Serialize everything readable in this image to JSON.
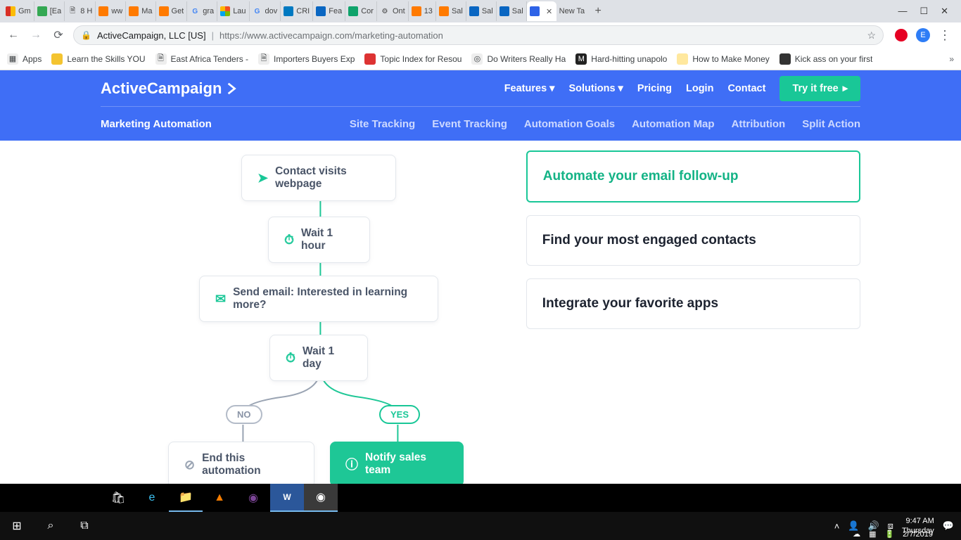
{
  "browser": {
    "tabs": [
      {
        "title": "Gm",
        "color": "#d93025"
      },
      {
        "title": "[Ea",
        "color": "#34a853"
      },
      {
        "title": "8 H",
        "color": "#ffffff"
      },
      {
        "title": "ww",
        "color": "#ff7a00"
      },
      {
        "title": "Ma",
        "color": "#ff7a00"
      },
      {
        "title": "Get",
        "color": "#ff7a00"
      },
      {
        "title": "gra",
        "color": "#4285f4"
      },
      {
        "title": "Lau",
        "color": "#00a4ef"
      },
      {
        "title": "dov",
        "color": "#4285f4"
      },
      {
        "title": "CRI",
        "color": "#0079c1"
      },
      {
        "title": "Fea",
        "color": "#0a66c2"
      },
      {
        "title": "Cor",
        "color": "#0fa36b"
      },
      {
        "title": "Ont",
        "color": "#555"
      },
      {
        "title": "13",
        "color": "#ff7a00"
      },
      {
        "title": "Sal",
        "color": "#ff7a00"
      },
      {
        "title": "Sal",
        "color": "#0a66c2"
      },
      {
        "title": "Sal",
        "color": "#0a66c2"
      }
    ],
    "active_tab_title": "",
    "new_tab_title": "New Ta",
    "origin": "ActiveCampaign, LLC [US]",
    "url_path": "https://www.activecampaign.com/marketing-automation",
    "avatar_letter": "E",
    "bookmarks": [
      {
        "label": "Apps"
      },
      {
        "label": "Learn the Skills YOU"
      },
      {
        "label": "East Africa Tenders -"
      },
      {
        "label": "Importers Buyers Exp"
      },
      {
        "label": "Topic Index for Resou"
      },
      {
        "label": "Do Writers Really Ha"
      },
      {
        "label": "Hard-hitting unapolo"
      },
      {
        "label": "How to Make Money"
      },
      {
        "label": "Kick ass on your first"
      }
    ]
  },
  "page": {
    "brand": "ActiveCampaign",
    "nav1": {
      "features": "Features",
      "solutions": "Solutions",
      "pricing": "Pricing",
      "login": "Login",
      "contact": "Contact",
      "cta": "Try it free"
    },
    "crumb": "Marketing Automation",
    "nav2": [
      "Site Tracking",
      "Event Tracking",
      "Automation Goals",
      "Automation Map",
      "Attribution",
      "Split Action"
    ],
    "flow": {
      "n1": "Contact visits webpage",
      "n2": "Wait 1 hour",
      "n3": "Send email: Interested in learning more?",
      "n4": "Wait 1 day",
      "no": "NO",
      "yes": "YES",
      "end": "End this automation",
      "notify": "Notify sales team"
    },
    "cards": {
      "c1": "Automate your email follow-up",
      "c2": "Find your most engaged contacts",
      "c3": "Integrate your favorite apps"
    }
  },
  "taskbar": {
    "time": "9:47 AM",
    "day": "Thursday",
    "date": "2/7/2019"
  }
}
